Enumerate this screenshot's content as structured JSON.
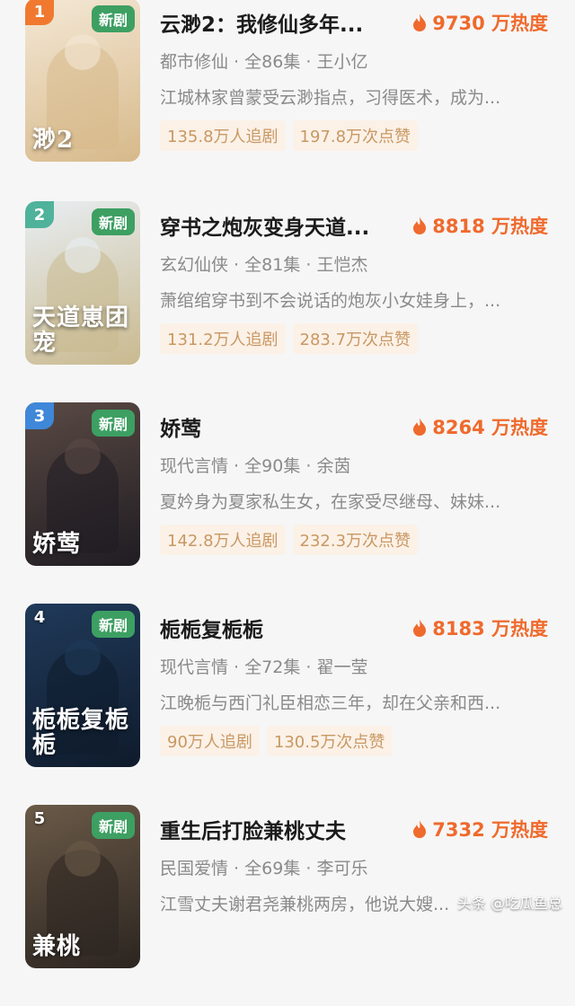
{
  "dramas": [
    {
      "rank": "1",
      "badge": "新剧",
      "poster_title": "渺2",
      "title": "云渺2：我修仙多年...",
      "heat": "9730 万热度",
      "genre": "都市修仙",
      "episodes": "全86集",
      "actor": "王小亿",
      "desc": "江城林家曾蒙受云渺指点，习得医术，成为...",
      "followers": "135.8万人追剧",
      "likes": "197.8万次点赞",
      "colors": [
        "#f4e8d6",
        "#d7b98a"
      ]
    },
    {
      "rank": "2",
      "badge": "新剧",
      "poster_title": "天道崽团宠",
      "title": "穿书之炮灰变身天道...",
      "heat": "8818 万热度",
      "genre": "玄幻仙侠",
      "episodes": "全81集",
      "actor": "王恺杰",
      "desc": "萧绾绾穿书到不会说话的炮灰小女娃身上，...",
      "followers": "131.2万人追剧",
      "likes": "283.7万次点赞",
      "colors": [
        "#e8eef3",
        "#c9b98e"
      ]
    },
    {
      "rank": "3",
      "badge": "新剧",
      "poster_title": "娇莺",
      "title": "娇莺",
      "heat": "8264 万热度",
      "genre": "现代言情",
      "episodes": "全90集",
      "actor": "余茵",
      "desc": "夏妗身为夏家私生女，在家受尽继母、妹妹...",
      "followers": "142.8万人追剧",
      "likes": "232.3万次点赞",
      "colors": [
        "#5a4a44",
        "#1f1c22"
      ]
    },
    {
      "rank": "4",
      "badge": "新剧",
      "poster_title": "栀栀复栀栀",
      "title": "栀栀复栀栀",
      "heat": "8183 万热度",
      "genre": "现代言情",
      "episodes": "全72集",
      "actor": "翟一莹",
      "desc": "江晚栀与西门礼臣相恋三年，却在父亲和西...",
      "followers": "90万人追剧",
      "likes": "130.5万次点赞",
      "colors": [
        "#203a5a",
        "#0f1b2c"
      ]
    },
    {
      "rank": "5",
      "badge": "新剧",
      "poster_title": "兼桃",
      "title": "重生后打脸兼桃丈夫",
      "heat": "7332 万热度",
      "genre": "民国爱情",
      "episodes": "全69集",
      "actor": "李可乐",
      "desc": "江雪丈夫谢君尧兼桃两房，他说大嫂...",
      "followers": "",
      "likes": "",
      "colors": [
        "#6b5a48",
        "#2b2520"
      ]
    }
  ],
  "watermark": "头条 @吃瓜鱼总"
}
